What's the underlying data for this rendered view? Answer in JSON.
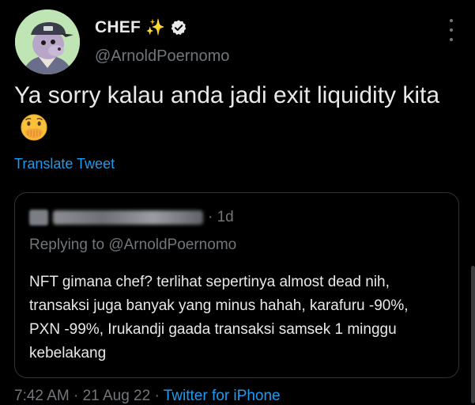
{
  "author": {
    "name": "CHEF",
    "name_emoji": "✨",
    "verified_icon": "verified-badge-icon",
    "handle": "@ArnoldPoernomo"
  },
  "tweet": {
    "text": "Ya sorry kalau anda jadi exit liquidity kita",
    "emoji": "face-with-hand-over-mouth-icon",
    "translate_label": "Translate Tweet"
  },
  "quote": {
    "time": "· 1d",
    "replying_to_prefix": "Replying to ",
    "replying_to_handle": "@ArnoldPoernomo",
    "body": "NFT gimana chef? terlihat sepertinya almost dead nih, transaksi juga banyak yang minus hahah, karafuru -90%, PXN -99%, Irukandji gaada transaksi samsek 1 minggu kebelakang"
  },
  "meta": {
    "time": "7:42 AM",
    "sep1": " · ",
    "date": "21 Aug 22",
    "sep2": " · ",
    "source": "Twitter for iPhone"
  },
  "colors": {
    "background": "#000000",
    "text": "#e7e9ea",
    "muted": "#71767b",
    "link": "#1d9bf0",
    "avatar_bg": "#bfe5b5"
  }
}
